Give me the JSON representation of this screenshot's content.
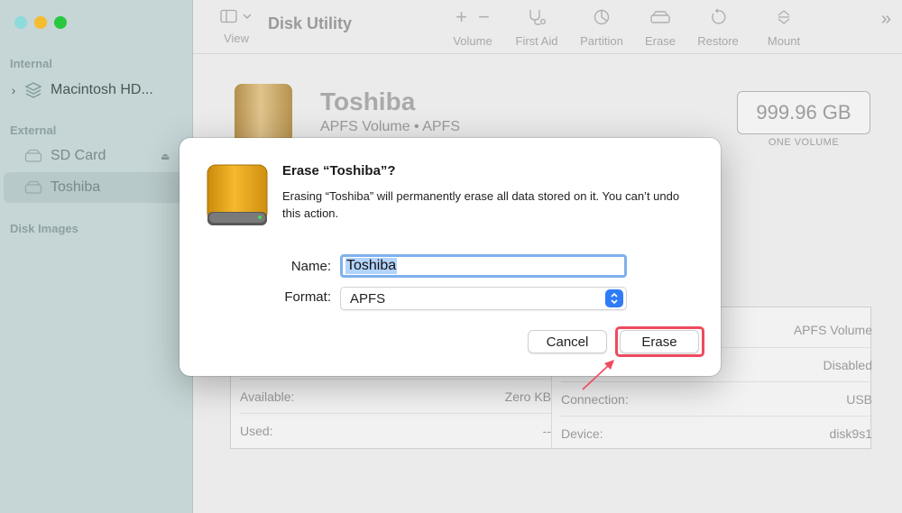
{
  "window": {
    "title": "Disk Utility"
  },
  "toolbar": {
    "view_label": "View",
    "buttons": [
      {
        "label": "Volume"
      },
      {
        "label": "First Aid"
      },
      {
        "label": "Partition"
      },
      {
        "label": "Erase"
      },
      {
        "label": "Restore"
      },
      {
        "label": "Mount"
      }
    ]
  },
  "sidebar": {
    "sections": {
      "internal": "Internal",
      "external": "External",
      "images": "Disk Images"
    },
    "items": [
      {
        "label": "Macintosh HD..."
      },
      {
        "label": "SD Card"
      },
      {
        "label": "Toshiba"
      }
    ]
  },
  "main": {
    "volume_name": "Toshiba",
    "volume_type": "APFS Volume • APFS",
    "capacity": "999.96 GB",
    "capacity_sub": "ONE VOLUME",
    "info": {
      "left": [
        {
          "label": "",
          "value": ""
        },
        {
          "label": "",
          "value": ""
        },
        {
          "label": "Available:",
          "value": "Zero KB"
        },
        {
          "label": "Used:",
          "value": "--"
        }
      ],
      "right": [
        {
          "label": "",
          "value": "APFS Volume"
        },
        {
          "label": "",
          "value": "Disabled"
        },
        {
          "label": "Connection:",
          "value": "USB"
        },
        {
          "label": "Device:",
          "value": "disk9s1"
        }
      ]
    }
  },
  "dialog": {
    "title": "Erase “Toshiba”?",
    "message": "Erasing “Toshiba” will permanently erase all data stored on it. You can’t undo this action.",
    "name_label": "Name:",
    "name_value": "Toshiba",
    "format_label": "Format:",
    "format_value": "APFS",
    "cancel_label": "Cancel",
    "erase_label": "Erase"
  },
  "colors": {
    "accent": "#2f7cf6",
    "highlight": "#ef4a5e",
    "sidebar": "#c6d6d6",
    "drive_gold": "#e9a619"
  }
}
